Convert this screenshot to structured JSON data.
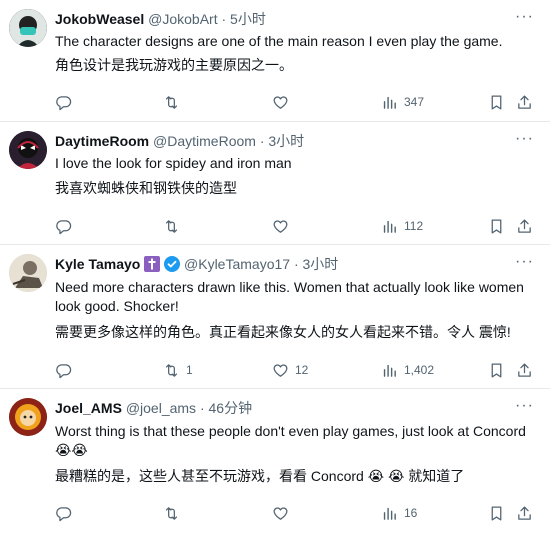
{
  "tweets": [
    {
      "name": "JokobWeasel",
      "handle": "@JokobArt",
      "sep": "·",
      "time": "5小时",
      "text": "The character designs are one of the main reason I even play the game.",
      "translation": "角色设计是我玩游戏的主要原因之一。",
      "replies": "",
      "retweets": "",
      "likes": "",
      "views": "347"
    },
    {
      "name": "DaytimeRoom",
      "handle": "@DaytimeRoom",
      "sep": "·",
      "time": "3小时",
      "text": "I love the look for spidey and iron man",
      "translation": "我喜欢蜘蛛侠和钢铁侠的造型",
      "replies": "",
      "retweets": "",
      "likes": "",
      "views": "112"
    },
    {
      "name": "Kyle Tamayo",
      "name_emoji": "✝️",
      "handle": "@KyleTamayo17",
      "sep": "·",
      "time": "3小时",
      "text": "Need more characters drawn like this. Women that actually look like women look good. Shocker!",
      "translation": "需要更多像这样的角色。真正看起来像女人的女人看起来不错。令人 震惊!",
      "replies": "",
      "retweets": "1",
      "likes": "12",
      "views": "1,402"
    },
    {
      "name": "Joel_AMS",
      "handle": "@joel_ams",
      "sep": "·",
      "time": "46分钟",
      "text": "Worst thing is that these people don't even play games, just look at Concord 😭😭",
      "translation": "最糟糕的是，这些人甚至不玩游戏，看看 Concord 😭 😭 就知道了",
      "replies": "",
      "retweets": "",
      "likes": "",
      "views": "16"
    }
  ],
  "icons": {
    "reply": "reply-icon",
    "retweet": "retweet-icon",
    "like": "heart-icon",
    "views": "views-icon",
    "bookmark": "bookmark-icon",
    "share": "share-icon",
    "more": "more-icon",
    "verified": "verified-badge-icon"
  },
  "colors": {
    "text": "#0f1419",
    "muted": "#536471",
    "divider": "#e6e9ec",
    "verified": "#1d9bf0",
    "cross_badge": "#8b5fbf"
  }
}
